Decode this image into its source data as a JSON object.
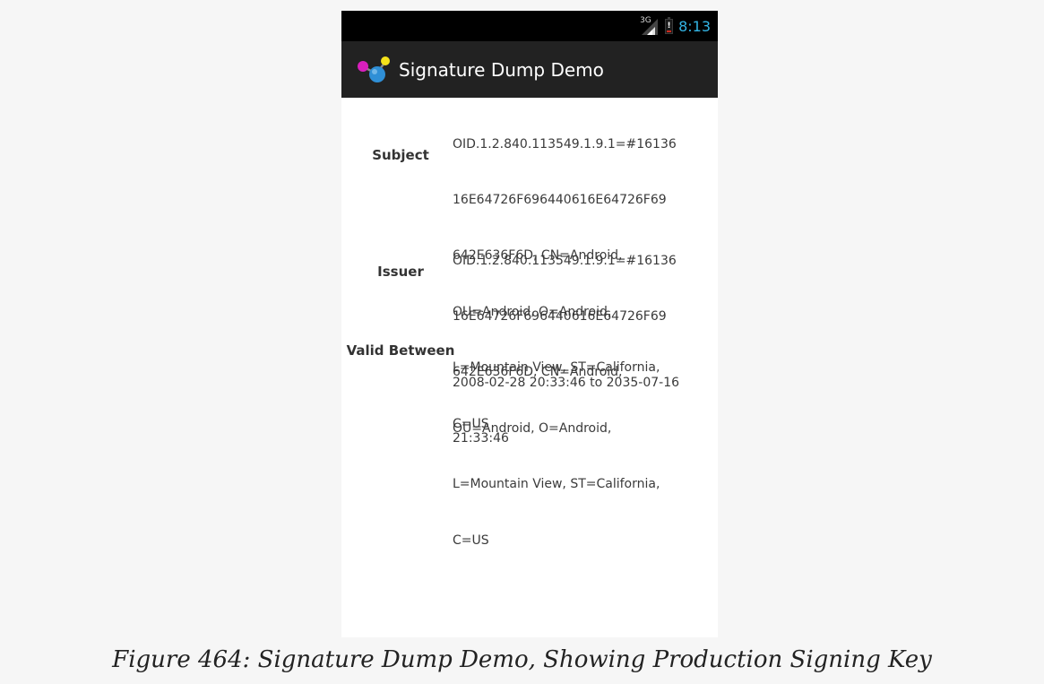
{
  "status_bar": {
    "network_type": "3G",
    "time": "8:13",
    "battery_level": 0.15,
    "battery_warning": "!"
  },
  "action_bar": {
    "app_icon": "molecule-app-icon",
    "title": "Signature Dump Demo"
  },
  "signature": {
    "rows": [
      {
        "label": "Subject",
        "lines": [
          "OID.1.2.840.113549.1.9.1=#16136",
          "16E64726F696440616E64726F69",
          "642E636F6D, CN=Android,",
          "OU=Android, O=Android,",
          "L=Mountain View, ST=California,",
          "C=US"
        ]
      },
      {
        "label": "Issuer",
        "lines": [
          "OID.1.2.840.113549.1.9.1=#16136",
          "16E64726F696440616E64726F69",
          "642E636F6D, CN=Android,",
          "OU=Android, O=Android,",
          "L=Mountain View, ST=California,",
          "C=US"
        ]
      },
      {
        "label": "Valid Between",
        "lines": [
          "2008-02-28 20:33:46 to 2035-07-16",
          "21:33:46"
        ]
      }
    ]
  },
  "caption": "Figure 464: Signature Dump Demo, Showing Production Signing Key",
  "colors": {
    "status_bar_bg": "#000000",
    "action_bar_bg": "#222222",
    "clock": "#33b5e5",
    "battery_alert": "#cc2a1e"
  }
}
